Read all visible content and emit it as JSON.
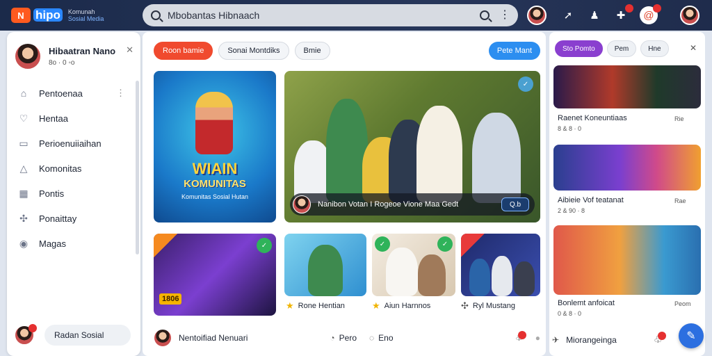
{
  "app": {
    "logo_badge": "N",
    "logo_word": "hipo",
    "logo_line1": "Komunah",
    "logo_line2": "Sosial Media"
  },
  "search": {
    "placeholder": "Mbobantas Hibnaach",
    "icon": "search-icon"
  },
  "profile": {
    "name": "Hibaatran Nano",
    "meta": "8o · 0 ◦o"
  },
  "nav": {
    "items": [
      {
        "label": "Pentoenaa",
        "icon": "home-icon"
      },
      {
        "label": "Hentaa",
        "icon": "heart-icon"
      },
      {
        "label": "Perioenuiiaihan",
        "icon": "folder-icon"
      },
      {
        "label": "Komonitas",
        "icon": "triangle-icon"
      },
      {
        "label": "Pontis",
        "icon": "grid-icon"
      },
      {
        "label": "Ponaittay",
        "icon": "puzzle-icon"
      },
      {
        "label": "Magas",
        "icon": "globe-icon"
      }
    ]
  },
  "side_footer": {
    "label": "Radan Sosial"
  },
  "filters": {
    "chips": [
      "Roon bamie",
      "Sonai Montdiks",
      "Bmie"
    ],
    "post_button": "Pete Mant"
  },
  "game_card": {
    "title1": "WIAIN",
    "title2": "KOMUNITAS",
    "sub": "Komunitas Sosial Hutan"
  },
  "hero": {
    "caption": "Nanibon Votan I Rogeoe Vione Maa Gedt",
    "play": "Q.b"
  },
  "thumbs": [
    {
      "label": "Rone Hentian",
      "icon": "star-icon",
      "badge": "1806"
    },
    {
      "label": "Aiun Harnnos",
      "icon": "star-icon"
    },
    {
      "label": "Ryl Mustang",
      "icon": "puzzle-icon"
    }
  ],
  "bottom_bar": {
    "left": "Nentoifiad Nenuari",
    "mid": "Pero",
    "mid2": "Eno",
    "right": "Miorangeinga"
  },
  "right_panel": {
    "chips": [
      "Sto Pomto",
      "Pem",
      "Hne"
    ],
    "cards": [
      {
        "title": "Raenet Koneuntiaas",
        "meta": "8 & 8 · 0",
        "side": "Rie"
      },
      {
        "title": "Aibieie Vof teatanat",
        "meta": "2 & 90 · 8",
        "side": "Rae"
      },
      {
        "title": "Bonlemt anfoicat",
        "meta": "0 & 8 · 0",
        "side": "Peom"
      }
    ]
  },
  "colors": {
    "accent": "#f04a2e",
    "primary": "#2c8ef0",
    "topbar": "#1b2a4a",
    "purple": "#8a3fcf"
  }
}
